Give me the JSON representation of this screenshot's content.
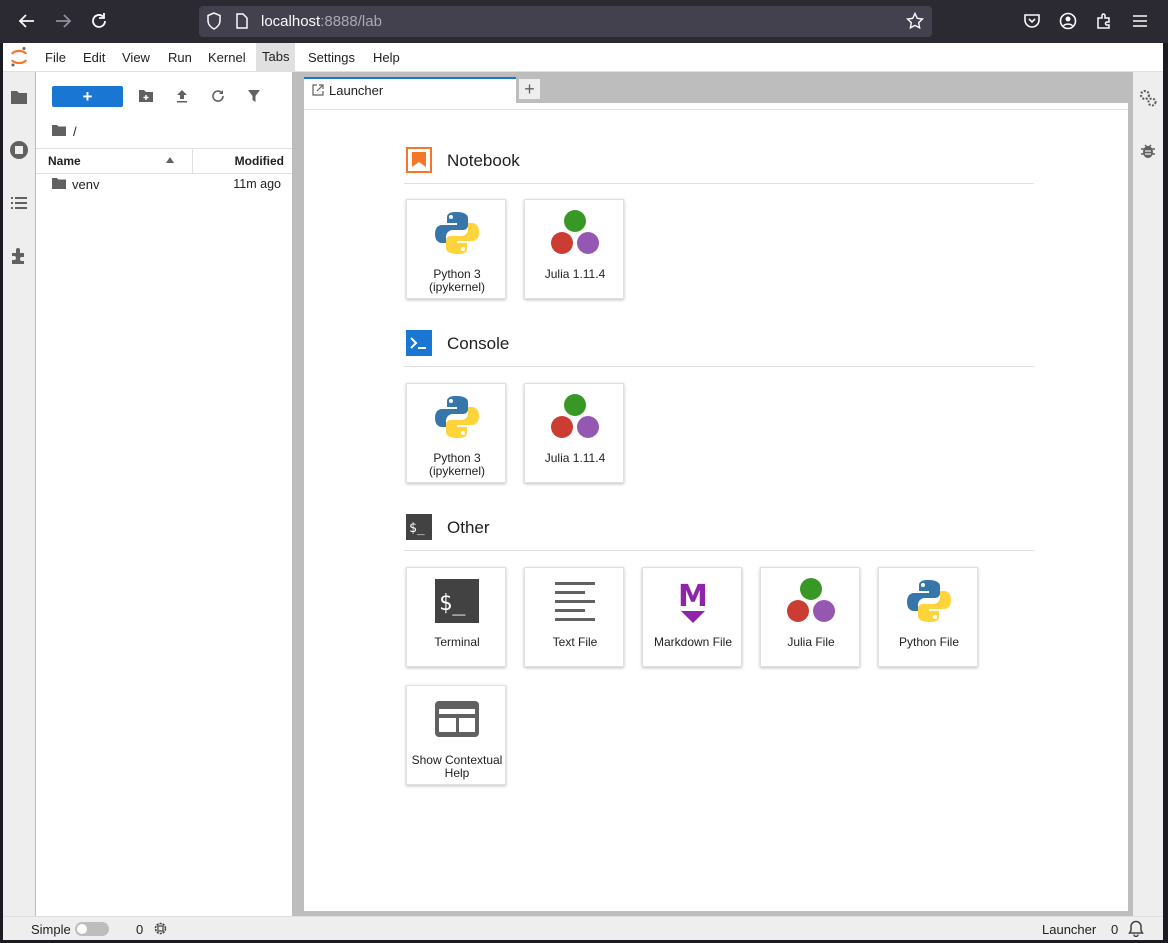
{
  "browser": {
    "url_host": "localhost",
    "url_path": ":8888/lab"
  },
  "menu": {
    "items": [
      "File",
      "Edit",
      "View",
      "Run",
      "Kernel",
      "Tabs",
      "Settings",
      "Help"
    ]
  },
  "file_browser": {
    "new_label": "+",
    "breadcrumb": "/",
    "column_name": "Name",
    "column_modified": "Modified",
    "files": [
      {
        "name": "venv",
        "modified": "11m ago"
      }
    ]
  },
  "tabs": [
    {
      "label": "Launcher"
    }
  ],
  "launcher": {
    "sections": [
      {
        "title": "Notebook",
        "cards": [
          {
            "label": "Python 3 (ipykernel)",
            "icon": "python-logo-icon"
          },
          {
            "label": "Julia 1.11.4",
            "icon": "julia-logo-icon"
          }
        ]
      },
      {
        "title": "Console",
        "cards": [
          {
            "label": "Python 3 (ipykernel)",
            "icon": "python-logo-icon"
          },
          {
            "label": "Julia 1.11.4",
            "icon": "julia-logo-icon"
          }
        ]
      },
      {
        "title": "Other",
        "cards": [
          {
            "label": "Terminal",
            "icon": "terminal-icon"
          },
          {
            "label": "Text File",
            "icon": "text-file-icon"
          },
          {
            "label": "Markdown File",
            "icon": "markdown-icon"
          },
          {
            "label": "Julia File",
            "icon": "julia-logo-icon"
          },
          {
            "label": "Python File",
            "icon": "python-logo-icon"
          },
          {
            "label": "Show Contextual Help",
            "icon": "contextual-help-icon"
          }
        ]
      }
    ]
  },
  "status_bar": {
    "mode_label": "Simple",
    "kernels_count": "0",
    "current_label": "Launcher",
    "notifications_count": "0"
  },
  "colors": {
    "brand_orange": "#f37726",
    "accent_blue": "#1976d2",
    "console_blue": "#1976d2",
    "terminal_gray": "#424242",
    "markdown_purple": "#8e24aa",
    "julia_green": "#389826",
    "julia_red": "#cb3c33",
    "julia_purple": "#9558b2"
  }
}
